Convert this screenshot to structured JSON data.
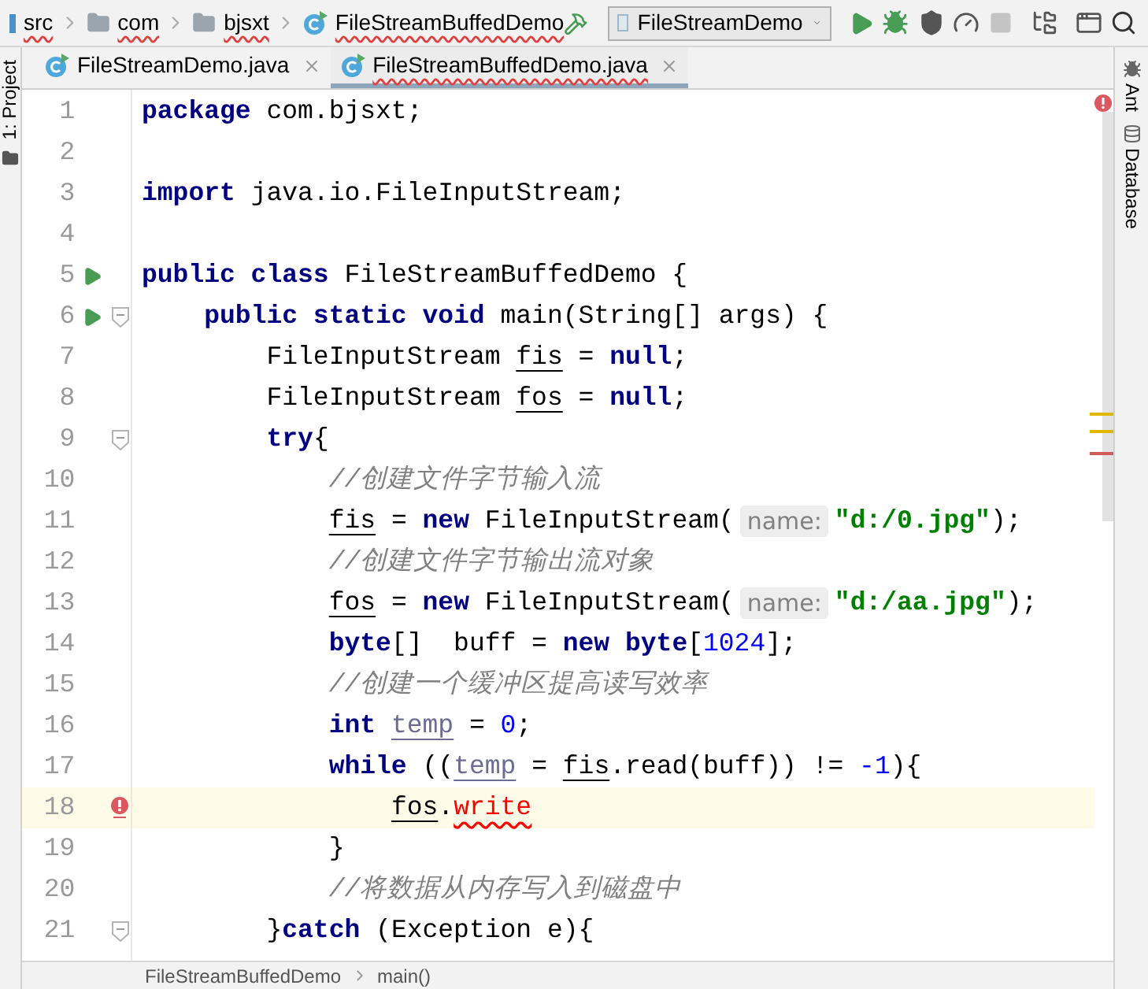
{
  "breadcrumbs": [
    {
      "label": "src",
      "kind": "source",
      "error": true
    },
    {
      "label": "com",
      "kind": "package",
      "error": true
    },
    {
      "label": "bjsxt",
      "kind": "package",
      "error": true
    },
    {
      "label": "FileStreamBuffedDemo",
      "kind": "class",
      "error": true
    }
  ],
  "run_config": {
    "label": "FileStreamDemo"
  },
  "toolbar_buttons": [
    {
      "kind": "run",
      "disabled": false
    },
    {
      "kind": "debug",
      "disabled": false
    },
    {
      "kind": "coverage",
      "disabled": false
    },
    {
      "kind": "profile",
      "disabled": false
    },
    {
      "kind": "stop",
      "disabled": true
    },
    {
      "kind": "structure",
      "disabled": false
    },
    {
      "kind": "terminal",
      "disabled": false
    },
    {
      "kind": "search",
      "disabled": false
    }
  ],
  "left_tools": [
    {
      "label": "1: Project"
    }
  ],
  "right_tools": [
    {
      "label": "Ant",
      "kind": "ant"
    },
    {
      "label": "Database",
      "kind": "database"
    }
  ],
  "tabs": [
    {
      "label": "FileStreamDemo.java",
      "selected": false,
      "error": false
    },
    {
      "label": "FileStreamBuffedDemo.java",
      "selected": true,
      "error": true
    }
  ],
  "lines": [
    {
      "number": "1",
      "run": false,
      "fold": false,
      "error": false,
      "current": false,
      "segments": [
        {
          "kind": "keyword",
          "text": "package"
        },
        {
          "kind": "plain",
          "text": " com.bjsxt;"
        }
      ]
    },
    {
      "number": "2",
      "run": false,
      "fold": false,
      "error": false,
      "current": false
    },
    {
      "number": "3",
      "run": false,
      "fold": false,
      "error": false,
      "current": false,
      "segments": [
        {
          "kind": "keyword",
          "text": "import"
        },
        {
          "kind": "plain",
          "text": " java.io.FileInputStream;"
        }
      ]
    },
    {
      "number": "4",
      "run": false,
      "fold": false,
      "error": false,
      "current": false
    },
    {
      "number": "5",
      "run": true,
      "fold": false,
      "error": false,
      "current": false,
      "segments": [
        {
          "kind": "keyword",
          "text": "public class"
        },
        {
          "kind": "plain",
          "text": " FileStreamBuffedDemo {"
        }
      ]
    },
    {
      "number": "6",
      "run": true,
      "fold": true,
      "error": false,
      "current": false,
      "segments": [
        {
          "kind": "keyword",
          "text": "    public static void"
        },
        {
          "kind": "plain",
          "text": " main(String[] args) {"
        }
      ]
    },
    {
      "number": "7",
      "run": false,
      "fold": false,
      "error": false,
      "current": false,
      "segments": [
        {
          "kind": "plain",
          "text": "        FileInputStream "
        },
        {
          "kind": "var",
          "text": "fis"
        },
        {
          "kind": "plain",
          "text": " = "
        },
        {
          "kind": "keyword",
          "text": "null"
        },
        {
          "kind": "plain",
          "text": ";"
        }
      ]
    },
    {
      "number": "8",
      "run": false,
      "fold": false,
      "error": false,
      "current": false,
      "segments": [
        {
          "kind": "plain",
          "text": "        FileInputStream "
        },
        {
          "kind": "var",
          "text": "fos"
        },
        {
          "kind": "plain",
          "text": " = "
        },
        {
          "kind": "keyword",
          "text": "null"
        },
        {
          "kind": "plain",
          "text": ";"
        }
      ]
    },
    {
      "number": "9",
      "run": false,
      "fold": true,
      "error": false,
      "current": false,
      "segments": [
        {
          "kind": "keyword",
          "text": "        try"
        },
        {
          "kind": "plain",
          "text": "{"
        }
      ]
    },
    {
      "number": "10",
      "run": false,
      "fold": false,
      "error": false,
      "current": false,
      "segments": [
        {
          "kind": "comment",
          "text": "            //创建文件字节输入流"
        }
      ]
    },
    {
      "number": "11",
      "run": false,
      "fold": false,
      "error": false,
      "current": false,
      "segments": [
        {
          "kind": "var",
          "text": "            fis"
        },
        {
          "kind": "plain",
          "text": " = "
        },
        {
          "kind": "keyword",
          "text": "new"
        },
        {
          "kind": "plain",
          "text": " FileInputStream("
        },
        {
          "kind": "hint",
          "text": "name:"
        },
        {
          "kind": "string",
          "text": "\"d:/0.jpg\""
        },
        {
          "kind": "plain",
          "text": ");"
        }
      ]
    },
    {
      "number": "12",
      "run": false,
      "fold": false,
      "error": false,
      "current": false,
      "segments": [
        {
          "kind": "comment",
          "text": "            //创建文件字节输出流对象"
        }
      ]
    },
    {
      "number": "13",
      "run": false,
      "fold": false,
      "error": false,
      "current": false,
      "segments": [
        {
          "kind": "var",
          "text": "            fos"
        },
        {
          "kind": "plain",
          "text": " = "
        },
        {
          "kind": "keyword",
          "text": "new"
        },
        {
          "kind": "plain",
          "text": " FileInputStream("
        },
        {
          "kind": "hint",
          "text": "name:"
        },
        {
          "kind": "string",
          "text": "\"d:/aa.jpg\""
        },
        {
          "kind": "plain",
          "text": ");"
        }
      ]
    },
    {
      "number": "14",
      "run": false,
      "fold": false,
      "error": false,
      "current": false,
      "segments": [
        {
          "kind": "keyword",
          "text": "            byte"
        },
        {
          "kind": "plain",
          "text": "[]  buff = "
        },
        {
          "kind": "keyword",
          "text": "new"
        },
        {
          "kind": "keyword",
          "text": " byte"
        },
        {
          "kind": "plain",
          "text": "["
        },
        {
          "kind": "number",
          "text": "1024"
        },
        {
          "kind": "plain",
          "text": "];"
        }
      ]
    },
    {
      "number": "15",
      "run": false,
      "fold": false,
      "error": false,
      "current": false,
      "segments": [
        {
          "kind": "comment",
          "text": "            //创建一个缓冲区提高读写效率"
        }
      ]
    },
    {
      "number": "16",
      "run": false,
      "fold": false,
      "error": false,
      "current": false,
      "segments": [
        {
          "kind": "keyword",
          "text": "            int"
        },
        {
          "kind": "var_dim",
          "text": " temp"
        },
        {
          "kind": "plain",
          "text": " = "
        },
        {
          "kind": "number",
          "text": "0"
        },
        {
          "kind": "plain",
          "text": ";"
        }
      ]
    },
    {
      "number": "17",
      "run": false,
      "fold": false,
      "error": false,
      "current": false,
      "segments": [
        {
          "kind": "keyword",
          "text": "            while"
        },
        {
          "kind": "plain",
          "text": " (("
        },
        {
          "kind": "var_dim",
          "text": "temp"
        },
        {
          "kind": "plain",
          "text": " = "
        },
        {
          "kind": "var",
          "text": "fis"
        },
        {
          "kind": "plain",
          "text": ".read(buff)) != "
        },
        {
          "kind": "number",
          "text": "-1"
        },
        {
          "kind": "plain",
          "text": "){"
        }
      ]
    },
    {
      "number": "18",
      "run": false,
      "fold": false,
      "error": true,
      "current": true,
      "segments": [
        {
          "kind": "var",
          "text": "                fos"
        },
        {
          "kind": "plain",
          "text": "."
        },
        {
          "kind": "error",
          "text": "write"
        }
      ]
    },
    {
      "number": "19",
      "run": false,
      "fold": false,
      "error": false,
      "current": false,
      "segments": [
        {
          "kind": "plain",
          "text": "            }"
        }
      ]
    },
    {
      "number": "20",
      "run": false,
      "fold": false,
      "error": false,
      "current": false,
      "segments": [
        {
          "kind": "comment",
          "text": "            //将数据从内存写入到磁盘中"
        }
      ]
    },
    {
      "number": "21",
      "run": false,
      "fold": true,
      "error": false,
      "current": false,
      "segments": [
        {
          "kind": "plain",
          "text": "        }"
        },
        {
          "kind": "keyword",
          "text": "catch"
        },
        {
          "kind": "plain",
          "text": " (Exception e){"
        }
      ]
    }
  ],
  "status_breadcrumbs": [
    "FileStreamBuffedDemo",
    "main()"
  ]
}
